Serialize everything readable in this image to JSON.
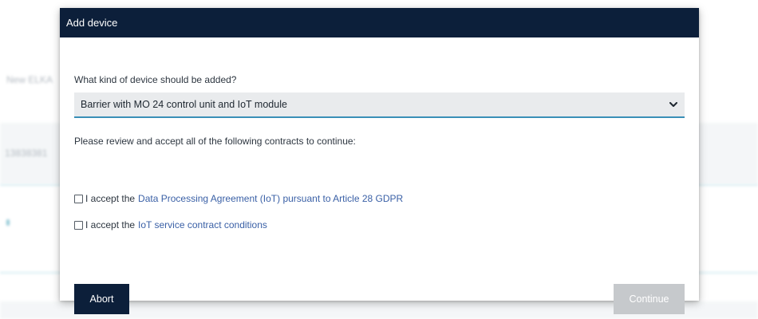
{
  "background": {
    "partial_text_1": "New ELKA",
    "partial_text_2": "13838381"
  },
  "modal": {
    "title": "Add device",
    "question": "What kind of device should be added?",
    "device_select": {
      "selected": "Barrier with MO 24 control unit and IoT module"
    },
    "contracts_intro": "Please review and accept all of the following contracts to continue:",
    "contracts": [
      {
        "prefix": "I accept the",
        "link": "Data Processing Agreement (IoT) pursuant to Article 28 GDPR",
        "checked": false
      },
      {
        "prefix": "I accept the",
        "link": "IoT service contract conditions",
        "checked": false
      }
    ],
    "abort_label": "Abort",
    "continue_label": "Continue",
    "continue_enabled": false
  },
  "colors": {
    "header_bg": "#0c1f3a",
    "link": "#3a60a6",
    "select_underline": "#3a8fb7",
    "disabled_button": "#c6c9cc"
  },
  "icons": {
    "select_chevron": "chevron-down-icon"
  }
}
